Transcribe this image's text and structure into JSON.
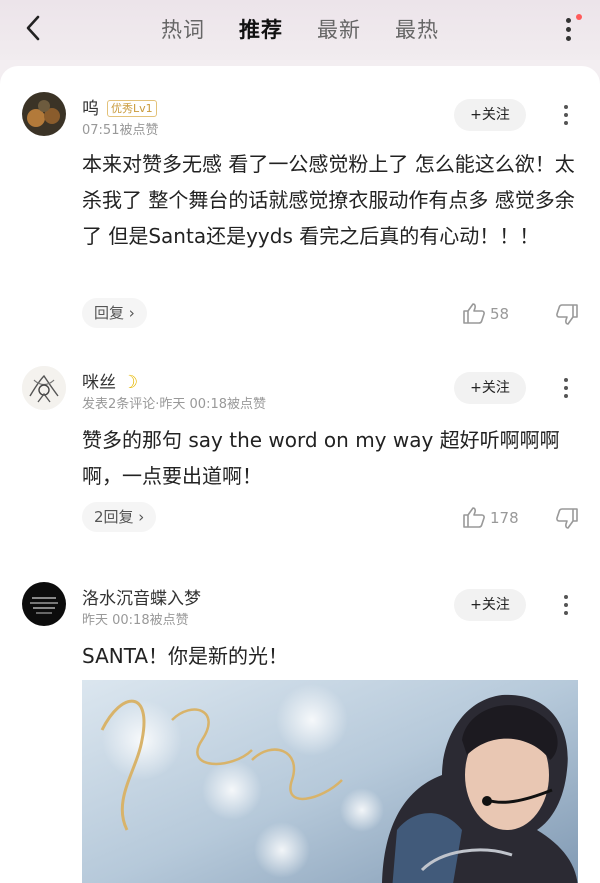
{
  "nav": {
    "tabs": [
      "热词",
      "推荐",
      "最新",
      "最热"
    ],
    "active": 1
  },
  "comments": [
    {
      "user": "呜",
      "badge": "优秀Lv1",
      "meta": "07:51被点赞",
      "follow": "+关注",
      "text": "本来对赞多无感 看了一公感觉粉上了 怎么能这么欲！太杀我了 整个舞台的话就感觉撩衣服动作有点多 感觉多余了 但是Santa还是yyds 看完之后真的有心动！！！",
      "reply": "回复 ›",
      "likes": "58"
    },
    {
      "user": "咪丝",
      "meta": "发表2条评论·昨天 00:18被点赞",
      "follow": "+关注",
      "text": "赞多的那句 say the word on my  way 超好听啊啊啊啊，一点要出道啊！",
      "reply": "2回复 ›",
      "likes": "178"
    },
    {
      "user": "洛水沉音蝶入梦",
      "meta": "昨天 00:18被点赞",
      "follow": "+关注",
      "text": "SANTA！你是新的光！"
    }
  ],
  "icons": {
    "back": "chevron-left-icon",
    "more": "more-vertical-icon",
    "like": "thumbs-up-icon",
    "dislike": "thumbs-down-icon"
  },
  "colors": {
    "accent_red": "#ff5b5b",
    "badge_gold": "#c99a3b"
  }
}
